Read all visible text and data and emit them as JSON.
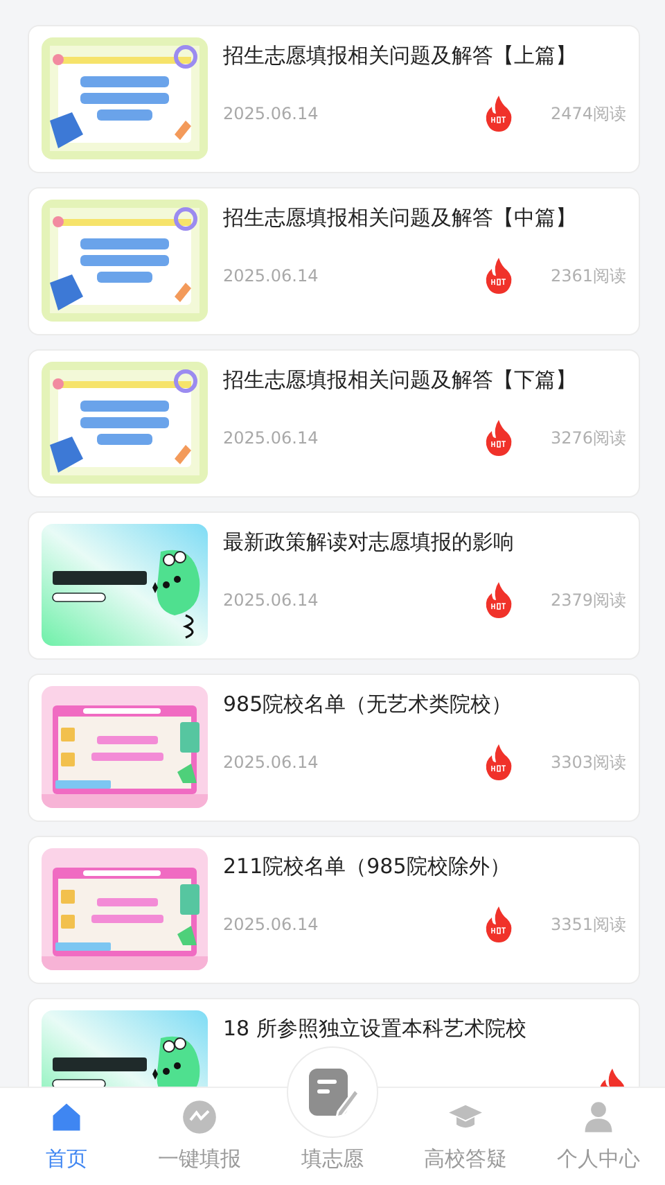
{
  "articles": [
    {
      "title": "招生志愿填报相关问题及解答【上篇】",
      "date": "2025.06.14",
      "hot": true,
      "reads": "2474阅读",
      "kind": "picture"
    },
    {
      "title": "招生志愿填报相关问题及解答【中篇】",
      "date": "2025.06.14",
      "hot": true,
      "reads": "2361阅读",
      "kind": "picture"
    },
    {
      "title": "招生志愿填报相关问题及解答【下篇】",
      "date": "2025.06.14",
      "hot": true,
      "reads": "3276阅读",
      "kind": "picture"
    },
    {
      "title": "最新政策解读对志愿填报的影响",
      "date": "2025.06.14",
      "hot": true,
      "reads": "2379阅读",
      "kind": "picture"
    },
    {
      "title": "985院校名单（无艺术类院校）",
      "date": "2025.06.14",
      "hot": true,
      "reads": "3303阅读",
      "kind": "picture"
    },
    {
      "title": "211院校名单（985院校除外）",
      "date": "2025.06.14",
      "hot": true,
      "reads": "3351阅读",
      "kind": "picture"
    },
    {
      "title": "18 所参照独立设置本科艺术院校",
      "hot": true,
      "kind": "picture"
    }
  ],
  "tab_bar": [
    {
      "label": "首页",
      "selected": true
    },
    {
      "label": "一键填报",
      "selected": false
    },
    {
      "label": "填志愿",
      "selected": false,
      "raised": true
    },
    {
      "label": "高校答疑",
      "selected": false
    },
    {
      "label": "个人中心",
      "selected": false
    }
  ]
}
